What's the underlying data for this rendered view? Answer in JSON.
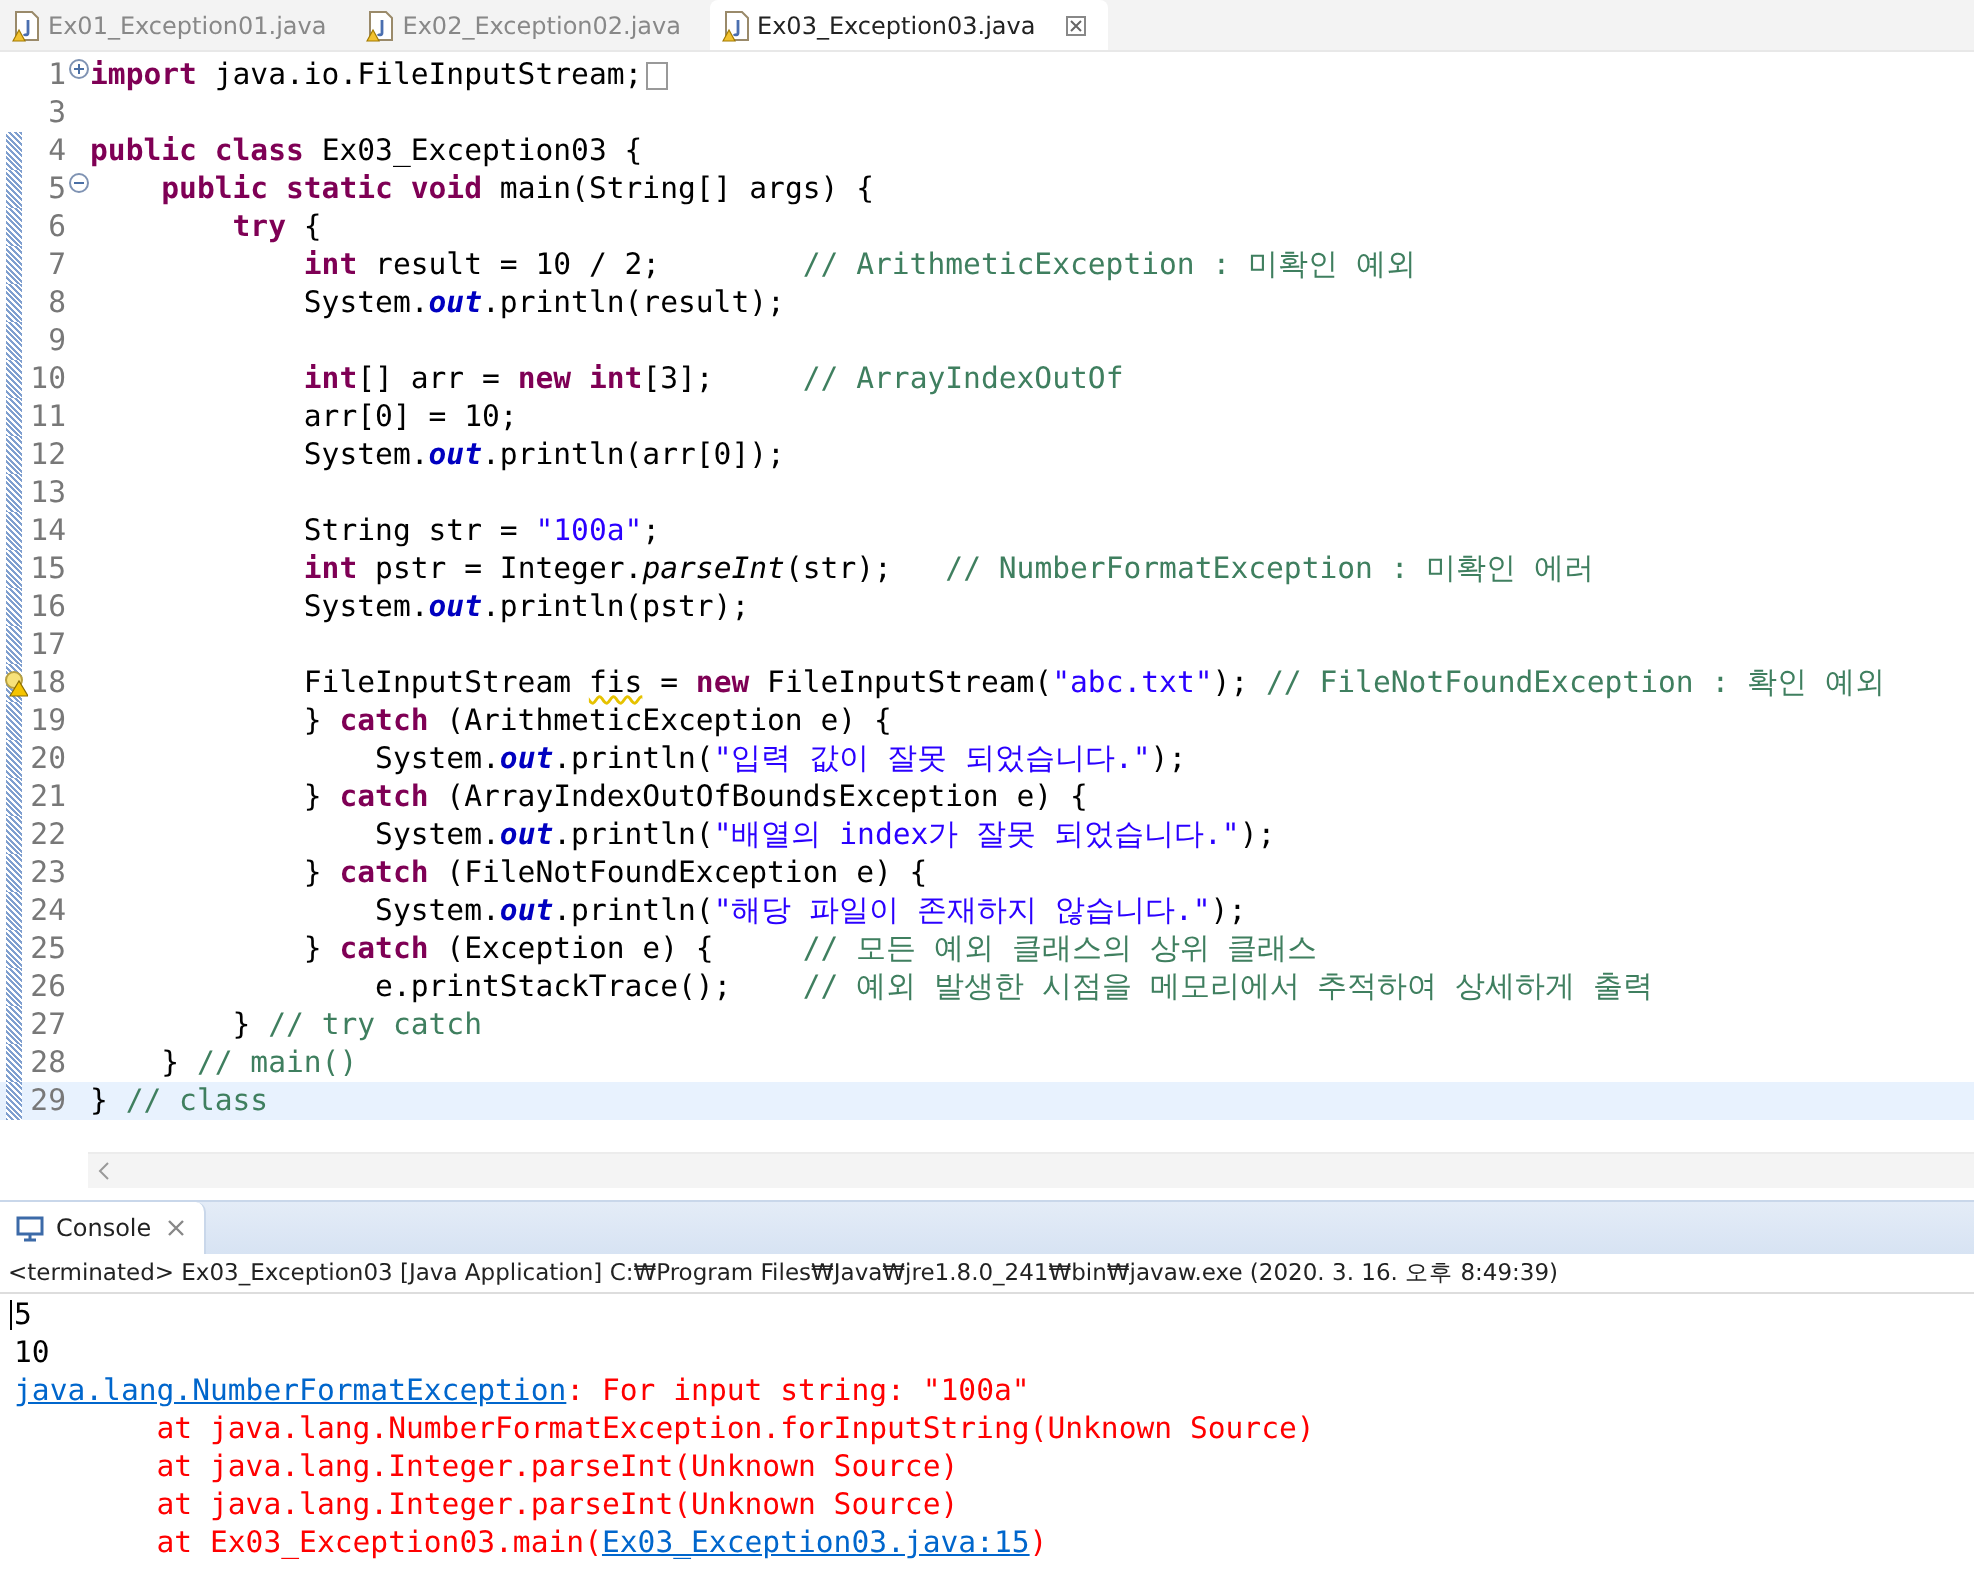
{
  "tabs": [
    {
      "label": "Ex01_Exception01.java",
      "selected": false
    },
    {
      "label": "Ex02_Exception02.java",
      "selected": false
    },
    {
      "label": "Ex03_Exception03.java",
      "selected": true
    }
  ],
  "editor": {
    "lines": [
      {
        "number": "1",
        "kind": "fold-plus",
        "folded": true,
        "changed": false,
        "current": false,
        "segments": [
          {
            "kind": "kw",
            "text": "import"
          },
          {
            "kind": "plain",
            "text": " java.io.FileInputStream;"
          }
        ]
      },
      {
        "number": "3",
        "kind": "plain",
        "changed": false,
        "current": false
      },
      {
        "number": "4",
        "kind": "plain",
        "changed": true,
        "current": false,
        "segments": [
          {
            "kind": "kw",
            "text": "public class"
          },
          {
            "kind": "plain",
            "text": " Ex03_Exception03 {"
          }
        ]
      },
      {
        "number": "5",
        "kind": "fold-minus",
        "changed": true,
        "current": false,
        "segments": [
          {
            "kind": "kw",
            "text": "    public static void"
          },
          {
            "kind": "plain",
            "text": " main(String[] args) {"
          }
        ]
      },
      {
        "number": "6",
        "kind": "plain",
        "changed": true,
        "current": false,
        "segments": [
          {
            "kind": "kw",
            "text": "        try"
          },
          {
            "kind": "plain",
            "text": " {"
          }
        ]
      },
      {
        "number": "7",
        "kind": "plain",
        "changed": true,
        "current": false,
        "segments": [
          {
            "kind": "kw",
            "text": "            int"
          },
          {
            "kind": "plain",
            "text": " result = 10 / 2;        "
          },
          {
            "kind": "cmt",
            "text": "// ArithmeticException : 미확인 예외"
          }
        ]
      },
      {
        "number": "8",
        "kind": "plain",
        "changed": true,
        "current": false,
        "segments": [
          {
            "kind": "plain",
            "text": "            System."
          },
          {
            "kind": "field",
            "text": "out"
          },
          {
            "kind": "plain",
            "text": ".println(result);"
          }
        ]
      },
      {
        "number": "9",
        "kind": "plain",
        "changed": true,
        "current": false
      },
      {
        "number": "10",
        "kind": "plain",
        "changed": true,
        "current": false,
        "segments": [
          {
            "kind": "kw",
            "text": "            int"
          },
          {
            "kind": "plain",
            "text": "[] arr = "
          },
          {
            "kind": "kw",
            "text": "new int"
          },
          {
            "kind": "plain",
            "text": "[3];     "
          },
          {
            "kind": "cmt",
            "text": "// ArrayIndexOutOf"
          }
        ]
      },
      {
        "number": "11",
        "kind": "plain",
        "changed": true,
        "current": false,
        "segments": [
          {
            "kind": "plain",
            "text": "            arr[0] = 10;"
          }
        ]
      },
      {
        "number": "12",
        "kind": "plain",
        "changed": true,
        "current": false,
        "segments": [
          {
            "kind": "plain",
            "text": "            System."
          },
          {
            "kind": "field",
            "text": "out"
          },
          {
            "kind": "plain",
            "text": ".println(arr[0]);"
          }
        ]
      },
      {
        "number": "13",
        "kind": "plain",
        "changed": true,
        "current": false
      },
      {
        "number": "14",
        "kind": "plain",
        "changed": true,
        "current": false,
        "segments": [
          {
            "kind": "plain",
            "text": "            String str = "
          },
          {
            "kind": "str",
            "text": "\"100a\""
          },
          {
            "kind": "plain",
            "text": ";"
          }
        ]
      },
      {
        "number": "15",
        "kind": "plain",
        "changed": true,
        "current": false,
        "segments": [
          {
            "kind": "kw",
            "text": "            int"
          },
          {
            "kind": "plain",
            "text": " pstr = Integer."
          },
          {
            "kind": "static",
            "text": "parseInt"
          },
          {
            "kind": "plain",
            "text": "(str);   "
          },
          {
            "kind": "cmt",
            "text": "// NumberFormatException : 미확인 에러"
          }
        ]
      },
      {
        "number": "16",
        "kind": "plain",
        "changed": true,
        "current": false,
        "segments": [
          {
            "kind": "plain",
            "text": "            System."
          },
          {
            "kind": "field",
            "text": "out"
          },
          {
            "kind": "plain",
            "text": ".println(pstr);"
          }
        ]
      },
      {
        "number": "17",
        "kind": "plain",
        "changed": true,
        "current": false
      },
      {
        "number": "18",
        "kind": "warning",
        "changed": true,
        "current": false,
        "segments": [
          {
            "kind": "plain",
            "text": "            FileInputStream "
          },
          {
            "kind": "warn",
            "text": "fis"
          },
          {
            "kind": "plain",
            "text": " = "
          },
          {
            "kind": "kw",
            "text": "new"
          },
          {
            "kind": "plain",
            "text": " FileInputStream("
          },
          {
            "kind": "str",
            "text": "\"abc.txt\""
          },
          {
            "kind": "plain",
            "text": "); "
          },
          {
            "kind": "cmt",
            "text": "// FileNotFoundException : 확인 예외"
          }
        ]
      },
      {
        "number": "19",
        "kind": "plain",
        "changed": true,
        "current": false,
        "segments": [
          {
            "kind": "plain",
            "text": "            } "
          },
          {
            "kind": "kw",
            "text": "catch"
          },
          {
            "kind": "plain",
            "text": " (ArithmeticException e) {"
          }
        ]
      },
      {
        "number": "20",
        "kind": "plain",
        "changed": true,
        "current": false,
        "segments": [
          {
            "kind": "plain",
            "text": "                System."
          },
          {
            "kind": "field",
            "text": "out"
          },
          {
            "kind": "plain",
            "text": ".println("
          },
          {
            "kind": "str",
            "text": "\"입력 값이 잘못 되었습니다.\""
          },
          {
            "kind": "plain",
            "text": ");"
          }
        ]
      },
      {
        "number": "21",
        "kind": "plain",
        "changed": true,
        "current": false,
        "segments": [
          {
            "kind": "plain",
            "text": "            } "
          },
          {
            "kind": "kw",
            "text": "catch"
          },
          {
            "kind": "plain",
            "text": " (ArrayIndexOutOfBoundsException e) {"
          }
        ]
      },
      {
        "number": "22",
        "kind": "plain",
        "changed": true,
        "current": false,
        "segments": [
          {
            "kind": "plain",
            "text": "                System."
          },
          {
            "kind": "field",
            "text": "out"
          },
          {
            "kind": "plain",
            "text": ".println("
          },
          {
            "kind": "str",
            "text": "\"배열의 index가 잘못 되었습니다.\""
          },
          {
            "kind": "plain",
            "text": ");"
          }
        ]
      },
      {
        "number": "23",
        "kind": "plain",
        "changed": true,
        "current": false,
        "segments": [
          {
            "kind": "plain",
            "text": "            } "
          },
          {
            "kind": "kw",
            "text": "catch"
          },
          {
            "kind": "plain",
            "text": " (FileNotFoundException e) {"
          }
        ]
      },
      {
        "number": "24",
        "kind": "plain",
        "changed": true,
        "current": false,
        "segments": [
          {
            "kind": "plain",
            "text": "                System."
          },
          {
            "kind": "field",
            "text": "out"
          },
          {
            "kind": "plain",
            "text": ".println("
          },
          {
            "kind": "str",
            "text": "\"해당 파일이 존재하지 않습니다.\""
          },
          {
            "kind": "plain",
            "text": ");"
          }
        ]
      },
      {
        "number": "25",
        "kind": "plain",
        "changed": true,
        "current": false,
        "segments": [
          {
            "kind": "plain",
            "text": "            } "
          },
          {
            "kind": "kw",
            "text": "catch"
          },
          {
            "kind": "plain",
            "text": " (Exception e) {     "
          },
          {
            "kind": "cmt",
            "text": "// 모든 예외 클래스의 상위 클래스"
          }
        ]
      },
      {
        "number": "26",
        "kind": "plain",
        "changed": true,
        "current": false,
        "segments": [
          {
            "kind": "plain",
            "text": "                e.printStackTrace();    "
          },
          {
            "kind": "cmt",
            "text": "// 예외 발생한 시점을 메모리에서 추적하여 상세하게 출력"
          }
        ]
      },
      {
        "number": "27",
        "kind": "plain",
        "changed": true,
        "current": false,
        "segments": [
          {
            "kind": "plain",
            "text": "        } "
          },
          {
            "kind": "cmt",
            "text": "// try catch"
          }
        ]
      },
      {
        "number": "28",
        "kind": "plain",
        "changed": true,
        "current": false,
        "segments": [
          {
            "kind": "plain",
            "text": "    } "
          },
          {
            "kind": "cmt",
            "text": "// main()"
          }
        ]
      },
      {
        "number": "29",
        "kind": "plain",
        "changed": true,
        "current": true,
        "segments": [
          {
            "kind": "plain",
            "text": "} "
          },
          {
            "kind": "cmt",
            "text": "// class"
          }
        ]
      }
    ]
  },
  "console": {
    "title": "Console",
    "header": "<terminated> Ex03_Exception03 [Java Application] C:₩Program Files₩Java₩jre1.8.0_241₩bin₩javaw.exe (2020. 3. 16. 오후 8:49:39)",
    "lines": [
      [
        {
          "kind": "out",
          "text": "5"
        }
      ],
      [
        {
          "kind": "out",
          "text": "10"
        }
      ],
      [
        {
          "kind": "link",
          "text": "java.lang.NumberFormatException"
        },
        {
          "kind": "err",
          "text": ": For input string: \"100a\""
        }
      ],
      [
        {
          "kind": "err",
          "text": "        at java.lang.NumberFormatException.forInputString(Unknown Source)"
        }
      ],
      [
        {
          "kind": "err",
          "text": "        at java.lang.Integer.parseInt(Unknown Source)"
        }
      ],
      [
        {
          "kind": "err",
          "text": "        at java.lang.Integer.parseInt(Unknown Source)"
        }
      ],
      [
        {
          "kind": "err",
          "text": "        at Ex03_Exception03.main("
        },
        {
          "kind": "link",
          "text": "Ex03_Exception03.java:15"
        },
        {
          "kind": "err",
          "text": ")"
        }
      ]
    ]
  }
}
